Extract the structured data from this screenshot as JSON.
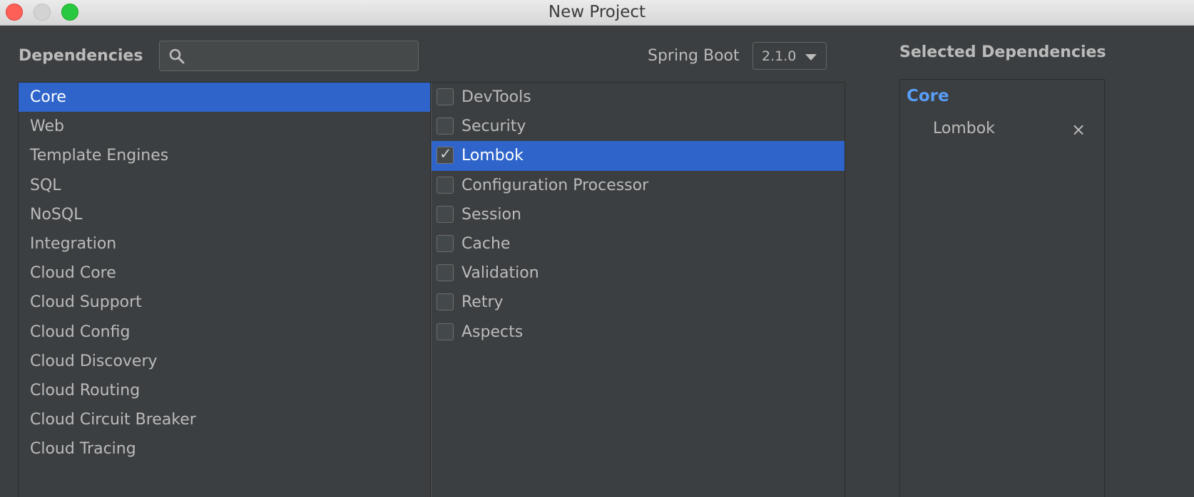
{
  "window": {
    "title": "New Project"
  },
  "header": {
    "dependencies_label": "Dependencies",
    "search": {
      "value": "",
      "placeholder": ""
    },
    "spring_boot_label": "Spring Boot",
    "spring_boot_version": "2.1.0"
  },
  "categories": [
    {
      "label": "Core",
      "selected": true
    },
    {
      "label": "Web"
    },
    {
      "label": "Template Engines"
    },
    {
      "label": "SQL"
    },
    {
      "label": "NoSQL"
    },
    {
      "label": "Integration"
    },
    {
      "label": "Cloud Core"
    },
    {
      "label": "Cloud Support"
    },
    {
      "label": "Cloud Config"
    },
    {
      "label": "Cloud Discovery"
    },
    {
      "label": "Cloud Routing"
    },
    {
      "label": "Cloud Circuit Breaker"
    },
    {
      "label": "Cloud Tracing"
    }
  ],
  "dependencies": [
    {
      "label": "DevTools",
      "checked": false
    },
    {
      "label": "Security",
      "checked": false
    },
    {
      "label": "Lombok",
      "checked": true,
      "selected": true
    },
    {
      "label": "Configuration Processor",
      "checked": false
    },
    {
      "label": "Session",
      "checked": false
    },
    {
      "label": "Cache",
      "checked": false
    },
    {
      "label": "Validation",
      "checked": false
    },
    {
      "label": "Retry",
      "checked": false
    },
    {
      "label": "Aspects",
      "checked": false
    }
  ],
  "selected_panel": {
    "title": "Selected Dependencies",
    "group": "Core",
    "items": [
      {
        "label": "Lombok",
        "remove_icon": "×"
      }
    ]
  },
  "check_glyph": "✓",
  "colors": {
    "selection": "#2f65ca",
    "group_header": "#589df6",
    "background": "#3c3f41"
  }
}
